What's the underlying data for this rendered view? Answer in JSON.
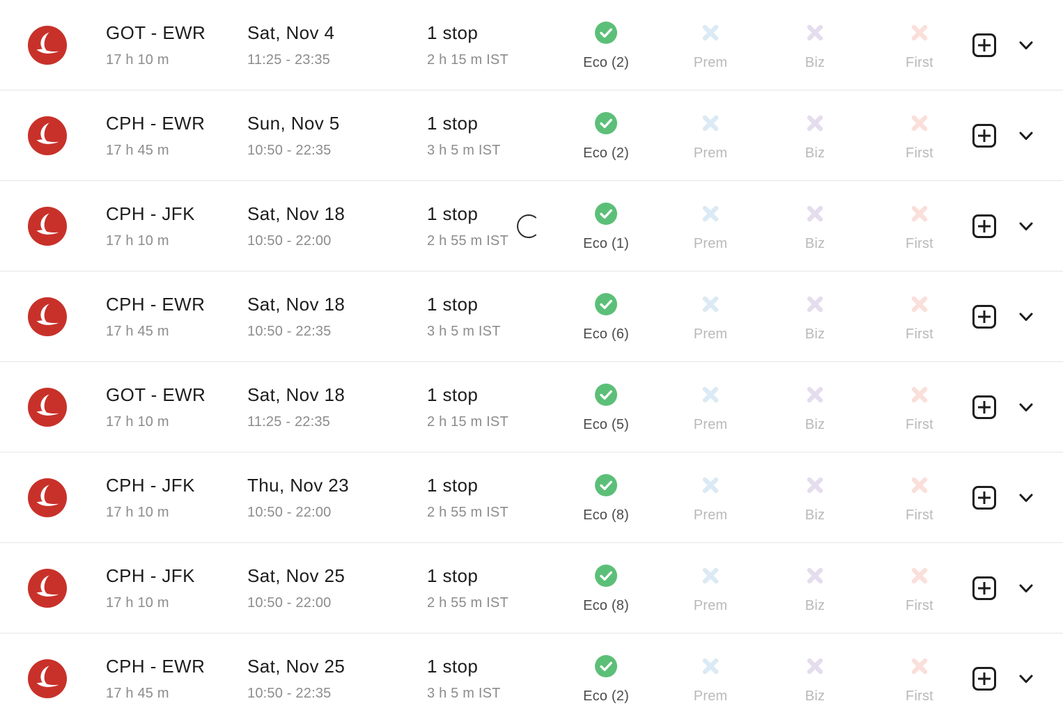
{
  "colors": {
    "airline_red": "#c8312a",
    "available_green": "#5cbf78",
    "prem_x": "#dbeaf4",
    "biz_x": "#e5dcee",
    "first_x": "#fadfdb",
    "primary_text": "#1d1d1d",
    "secondary_text": "#8c8c8c",
    "disabled_text": "#b9b9b9",
    "row_divider": "#e6e6e6"
  },
  "icons": {
    "airline_logo": "turkish-airlines-logo",
    "available": "check-circle-icon",
    "unavailable": "x-mark-icon",
    "add": "plus-square-icon",
    "expand": "chevron-down-icon",
    "loading": "spinner-icon"
  },
  "cabin_labels": {
    "economy": "Eco",
    "premium": "Prem",
    "business": "Biz",
    "first": "First"
  },
  "rows": [
    {
      "route": "GOT - EWR",
      "duration": "17 h 10 m",
      "date": "Sat, Nov 4",
      "times": "11:25 - 23:35",
      "stops": "1 stop",
      "layover": "2 h 15 m IST",
      "eco_label": "Eco (2)",
      "prem_label": "Prem",
      "biz_label": "Biz",
      "first_label": "First",
      "loading": false
    },
    {
      "route": "CPH - EWR",
      "duration": "17 h 45 m",
      "date": "Sun, Nov 5",
      "times": "10:50 - 22:35",
      "stops": "1 stop",
      "layover": "3 h 5 m IST",
      "eco_label": "Eco (2)",
      "prem_label": "Prem",
      "biz_label": "Biz",
      "first_label": "First",
      "loading": false
    },
    {
      "route": "CPH - JFK",
      "duration": "17 h 10 m",
      "date": "Sat, Nov 18",
      "times": "10:50 - 22:00",
      "stops": "1 stop",
      "layover": "2 h 55 m IST",
      "eco_label": "Eco (1)",
      "prem_label": "Prem",
      "biz_label": "Biz",
      "first_label": "First",
      "loading": true
    },
    {
      "route": "CPH - EWR",
      "duration": "17 h 45 m",
      "date": "Sat, Nov 18",
      "times": "10:50 - 22:35",
      "stops": "1 stop",
      "layover": "3 h 5 m IST",
      "eco_label": "Eco (6)",
      "prem_label": "Prem",
      "biz_label": "Biz",
      "first_label": "First",
      "loading": false
    },
    {
      "route": "GOT - EWR",
      "duration": "17 h 10 m",
      "date": "Sat, Nov 18",
      "times": "11:25 - 22:35",
      "stops": "1 stop",
      "layover": "2 h 15 m IST",
      "eco_label": "Eco (5)",
      "prem_label": "Prem",
      "biz_label": "Biz",
      "first_label": "First",
      "loading": false
    },
    {
      "route": "CPH - JFK",
      "duration": "17 h 10 m",
      "date": "Thu, Nov 23",
      "times": "10:50 - 22:00",
      "stops": "1 stop",
      "layover": "2 h 55 m IST",
      "eco_label": "Eco (8)",
      "prem_label": "Prem",
      "biz_label": "Biz",
      "first_label": "First",
      "loading": false
    },
    {
      "route": "CPH - JFK",
      "duration": "17 h 10 m",
      "date": "Sat, Nov 25",
      "times": "10:50 - 22:00",
      "stops": "1 stop",
      "layover": "2 h 55 m IST",
      "eco_label": "Eco (8)",
      "prem_label": "Prem",
      "biz_label": "Biz",
      "first_label": "First",
      "loading": false
    },
    {
      "route": "CPH - EWR",
      "duration": "17 h 45 m",
      "date": "Sat, Nov 25",
      "times": "10:50 - 22:35",
      "stops": "1 stop",
      "layover": "3 h 5 m IST",
      "eco_label": "Eco (2)",
      "prem_label": "Prem",
      "biz_label": "Biz",
      "first_label": "First",
      "loading": false
    }
  ]
}
